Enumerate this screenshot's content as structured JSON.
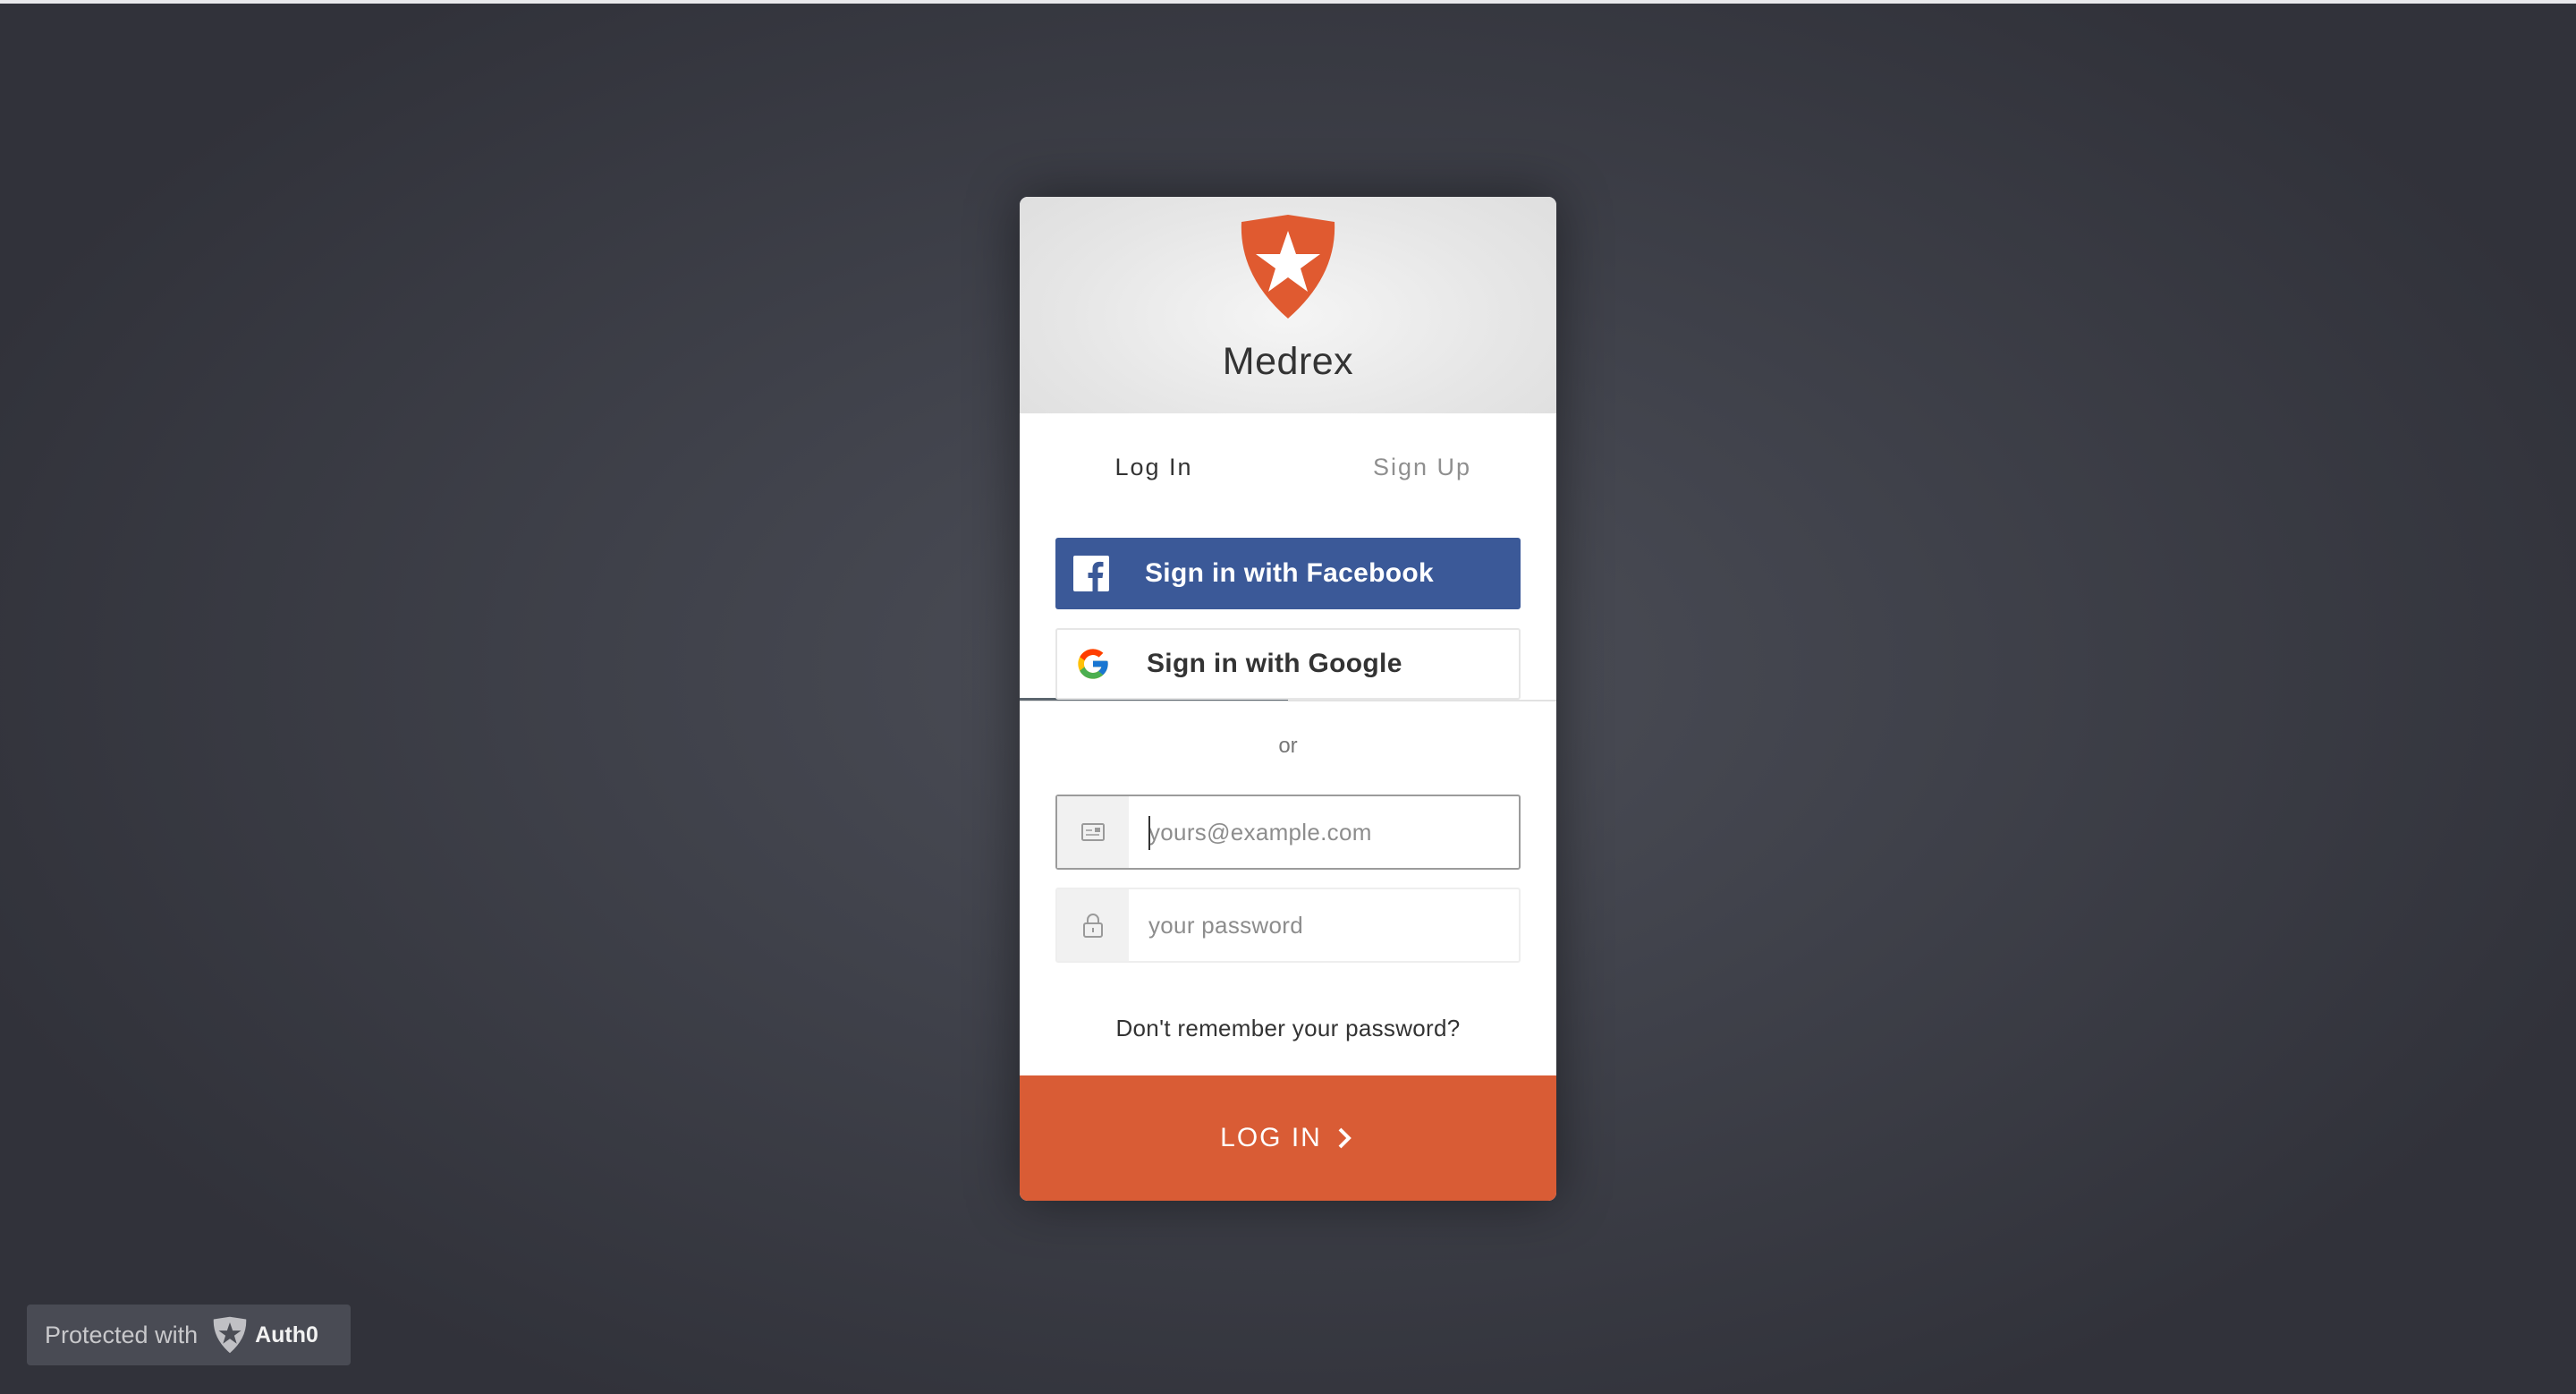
{
  "app": {
    "title": "Medrex",
    "brand_color": "#d95c35"
  },
  "tabs": [
    {
      "label": "Log In",
      "active": true
    },
    {
      "label": "Sign Up",
      "active": false
    }
  ],
  "social": {
    "facebook_label": "Sign in with Facebook",
    "facebook_color": "#3b5998",
    "facebook_icon": "facebook-icon",
    "google_label": "Sign in with Google",
    "google_icon": "google-icon"
  },
  "separator": "or",
  "form": {
    "email_placeholder": "yours@example.com",
    "email_value": "",
    "email_icon": "envelope-icon",
    "password_placeholder": "your password",
    "password_value": "",
    "password_icon": "lock-icon",
    "forgot_label": "Don't remember your password?",
    "submit_label": "LOG IN",
    "submit_icon": "chevron-right-icon"
  },
  "footer": {
    "protected_label": "Protected with",
    "brand_label": "Auth0",
    "brand_icon": "auth0-logo-icon"
  }
}
